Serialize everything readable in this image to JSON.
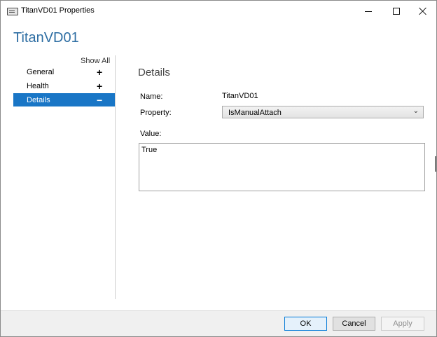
{
  "window": {
    "title": "TitanVD01 Properties",
    "heading": "TitanVD01"
  },
  "nav": {
    "show_all_label": "Show All",
    "items": [
      {
        "label": "General",
        "toggle": "+"
      },
      {
        "label": "Health",
        "toggle": "+"
      },
      {
        "label": "Details",
        "toggle": "−",
        "selected": true
      }
    ]
  },
  "details": {
    "section_title": "Details",
    "name_label": "Name:",
    "name_value": "TitanVD01",
    "property_label": "Property:",
    "property_selected": "IsManualAttach",
    "value_label": "Value:",
    "value_text": "True"
  },
  "footer": {
    "ok_label": "OK",
    "cancel_label": "Cancel",
    "apply_label": "Apply"
  },
  "colors": {
    "accent": "#1976c6",
    "heading": "#2e6ea3"
  }
}
